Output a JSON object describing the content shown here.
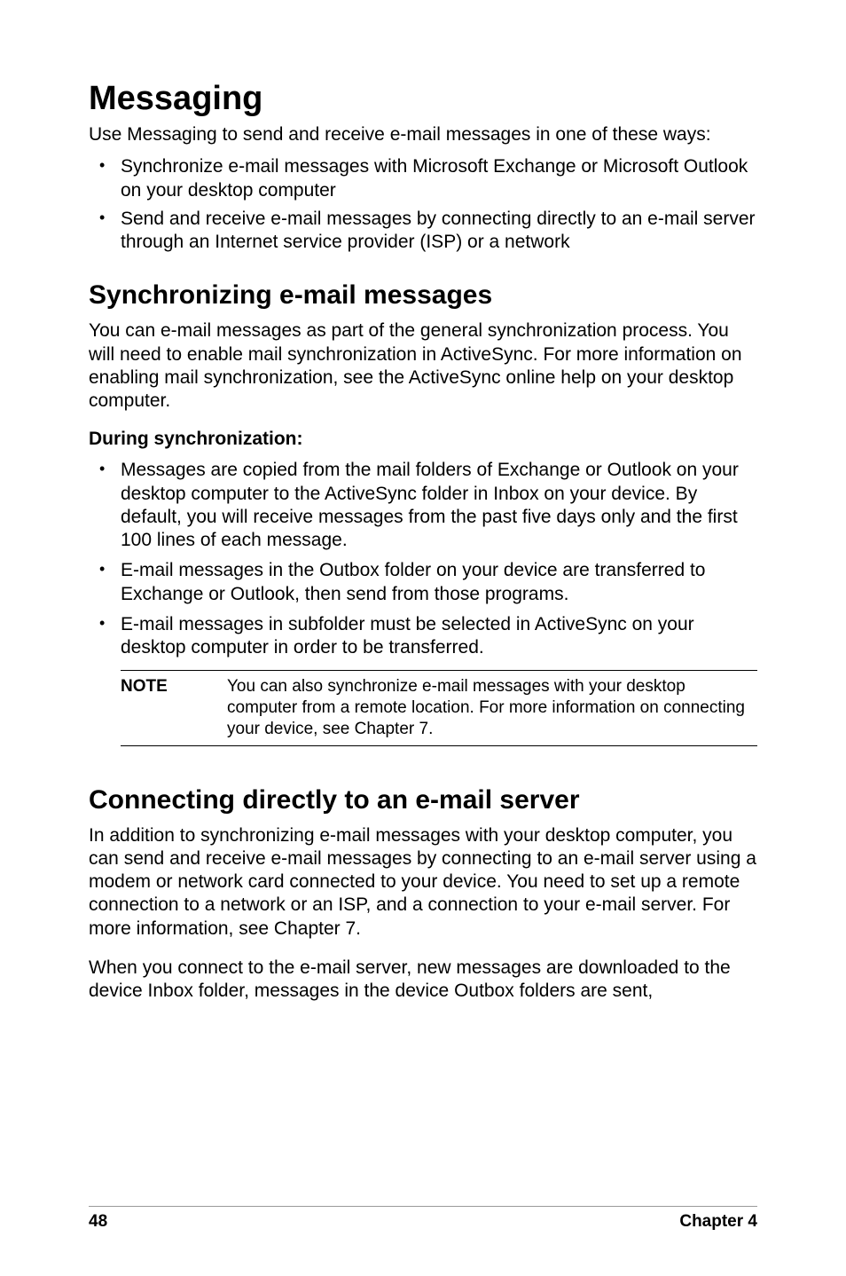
{
  "h1": "Messaging",
  "intro": "Use Messaging to send and receive e-mail messages in one of these ways:",
  "topList": [
    "Synchronize e-mail messages with Microsoft Exchange or Microsoft Outlook on your desktop computer",
    "Send and receive e-mail messages by connecting directly to an e-mail server through an Internet service provider (ISP) or a network"
  ],
  "h2a": "Synchronizing e-mail messages",
  "syncPara": "You can e-mail messages as part of the general synchronization process. You will need to enable mail synchronization in ActiveSync. For more information on enabling mail synchronization, see the ActiveSync online help on your desktop computer.",
  "h3": "During synchronization:",
  "subList": [
    "Messages are copied from the mail folders of Exchange or Outlook on your desktop computer to the ActiveSync folder in Inbox on your device. By default, you will receive messages from the past five days only and the first 100 lines of each message.",
    "E-mail messages in the Outbox folder on your device are transferred to Exchange or Outlook, then send from those programs.",
    "E-mail messages in subfolder must be selected in ActiveSync on your desktop computer in order to be transferred."
  ],
  "noteLabel": "NOTE",
  "noteText": "You can also synchronize e-mail messages with your desktop computer from a remote location. For more information on connecting your device, see Chapter 7.",
  "h2b": "Connecting directly to an e-mail server",
  "connPara1": "In addition to synchronizing e-mail messages with your desktop computer, you can send and receive e-mail messages by connecting to an e-mail server using a modem or network card connected to your device. You need to set up a remote connection to a network or an ISP, and a connection to your e-mail server. For more information, see Chapter 7.",
  "connPara2": "When you connect to the e-mail server, new messages are downloaded to the device Inbox folder, messages in the device Outbox folders are sent,",
  "pageNumber": "48",
  "chapterLabel": "Chapter 4"
}
